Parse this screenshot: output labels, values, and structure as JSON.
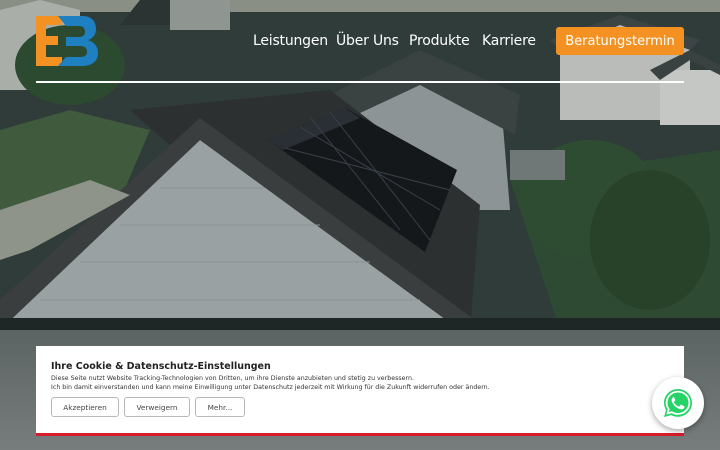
{
  "header": {
    "nav": [
      {
        "label": "Leistungen"
      },
      {
        "label": "Über Uns"
      },
      {
        "label": "Produkte"
      },
      {
        "label": "Karriere"
      }
    ],
    "cta_label": "Beratungstermin"
  },
  "colors": {
    "accent_orange": "#f39222",
    "logo_blue": "#1e7fc1",
    "cookie_border_red": "#d91c2a",
    "whatsapp_green": "#25d366"
  },
  "cookie_banner": {
    "title": "Ihre Cookie & Datenschutz-Einstellungen",
    "line1": "Diese Seite nutzt Website Tracking-Technologien von Dritten, um ihre Dienste anzubieten und stetig zu verbessern.",
    "line2": "Ich bin damit einverstanden und kann meine Einwilligung unter Datenschutz jederzeit mit Wirkung für die Zukunft widerrufen oder ändern.",
    "buttons": [
      {
        "label": "Akzeptieren"
      },
      {
        "label": "Verweigern"
      },
      {
        "label": "Mehr..."
      }
    ]
  },
  "icons": [
    "logo-eb",
    "whatsapp-icon"
  ]
}
